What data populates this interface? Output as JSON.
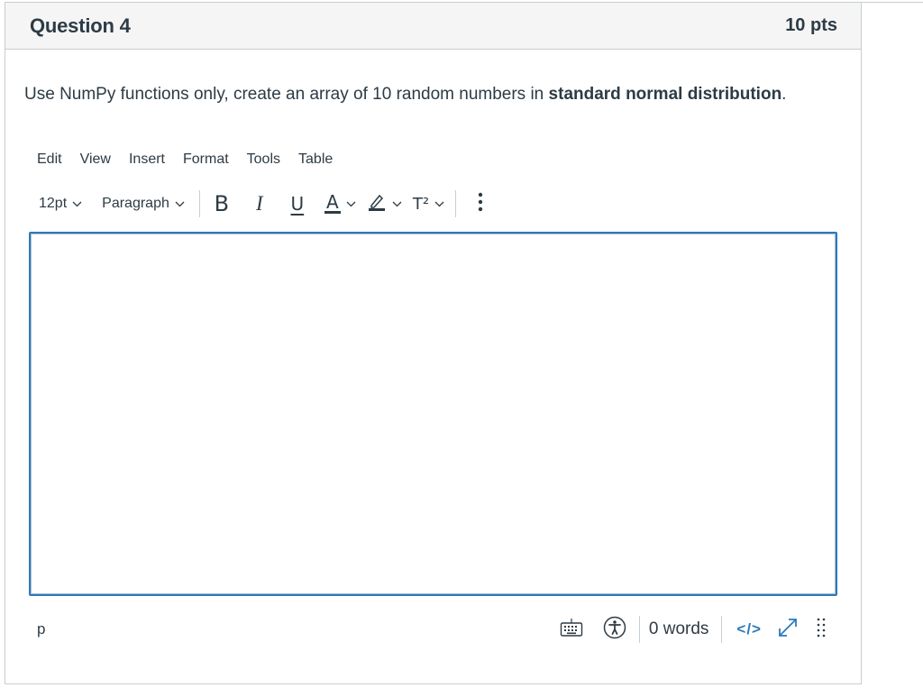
{
  "question": {
    "title": "Question 4",
    "points": "10 pts",
    "text_plain": "Use NumPy functions only, create an array of 10 random numbers in ",
    "text_bold": "standard normal distribution",
    "text_end": "."
  },
  "editor": {
    "menubar": [
      "Edit",
      "View",
      "Insert",
      "Format",
      "Tools",
      "Table"
    ],
    "toolbar": {
      "font_size": "12pt",
      "block_format": "Paragraph",
      "bold_label": "B",
      "italic_label": "I",
      "underline_label": "U",
      "text_color_label": "A",
      "superscript_label": "T²"
    },
    "status": {
      "path": "p",
      "word_count": "0 words",
      "html_label": "</>"
    }
  },
  "colors": {
    "accent": "#2b7abc",
    "text": "#2d3b45",
    "border": "#c7cdd1",
    "header_bg": "#f5f5f5"
  },
  "icons": [
    "chevron-down-icon",
    "highlighter-icon",
    "more-vertical-icon",
    "keyboard-icon",
    "accessibility-icon",
    "fullscreen-icon",
    "resize-grip-icon"
  ]
}
